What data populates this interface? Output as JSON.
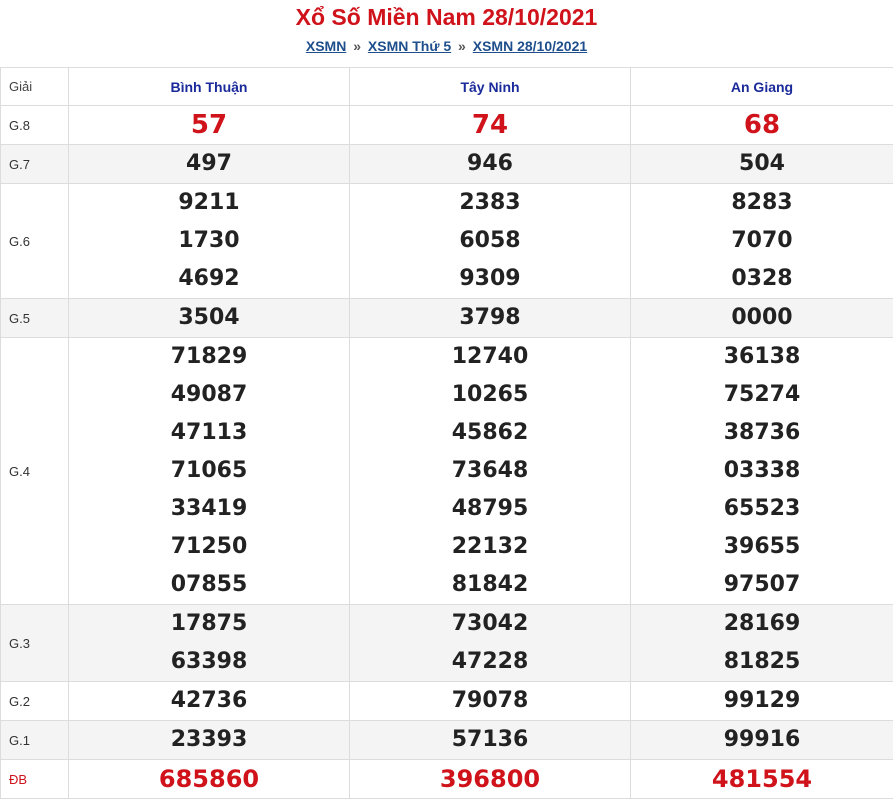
{
  "title": "Xổ Số Miền Nam 28/10/2021",
  "breadcrumb": {
    "items": [
      "XSMN",
      "XSMN Thứ 5",
      "XSMN 28/10/2021"
    ],
    "separator": "»"
  },
  "table": {
    "giai_header": "Giải",
    "provinces": [
      "Bình Thuận",
      "Tây Ninh",
      "An Giang"
    ],
    "rows": [
      {
        "label": "G.8",
        "values": [
          [
            "57"
          ],
          [
            "74"
          ],
          [
            "68"
          ]
        ]
      },
      {
        "label": "G.7",
        "values": [
          [
            "497"
          ],
          [
            "946"
          ],
          [
            "504"
          ]
        ]
      },
      {
        "label": "G.6",
        "values": [
          [
            "9211",
            "1730",
            "4692"
          ],
          [
            "2383",
            "6058",
            "9309"
          ],
          [
            "8283",
            "7070",
            "0328"
          ]
        ]
      },
      {
        "label": "G.5",
        "values": [
          [
            "3504"
          ],
          [
            "3798"
          ],
          [
            "0000"
          ]
        ]
      },
      {
        "label": "G.4",
        "values": [
          [
            "71829",
            "49087",
            "47113",
            "71065",
            "33419",
            "71250",
            "07855"
          ],
          [
            "12740",
            "10265",
            "45862",
            "73648",
            "48795",
            "22132",
            "81842"
          ],
          [
            "36138",
            "75274",
            "38736",
            "03338",
            "65523",
            "39655",
            "97507"
          ]
        ]
      },
      {
        "label": "G.3",
        "values": [
          [
            "17875",
            "63398"
          ],
          [
            "73042",
            "47228"
          ],
          [
            "28169",
            "81825"
          ]
        ]
      },
      {
        "label": "G.2",
        "values": [
          [
            "42736"
          ],
          [
            "79078"
          ],
          [
            "99129"
          ]
        ]
      },
      {
        "label": "G.1",
        "values": [
          [
            "23393"
          ],
          [
            "57136"
          ],
          [
            "99916"
          ]
        ]
      },
      {
        "label": "ĐB",
        "values": [
          [
            "685860"
          ],
          [
            "396800"
          ],
          [
            "481554"
          ]
        ]
      }
    ]
  },
  "colors": {
    "accent_red": "#d0121b",
    "province_blue": "#1a2a9a",
    "link_blue": "#1e4e8c",
    "row_alt": "#f4f4f4"
  }
}
